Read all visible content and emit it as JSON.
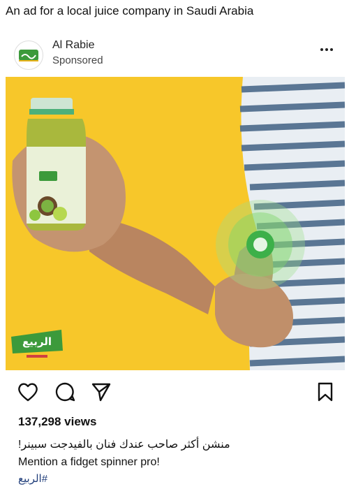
{
  "page": {
    "caption_top": "An ad for a local juice company in Saudi Arabia"
  },
  "post": {
    "author": "Al Rabie",
    "sponsored": "Sponsored",
    "more_icon": "more-horizontal-icon",
    "brand_colors": {
      "green": "#3c9a3b",
      "yellow_bg": "#f7c72a"
    },
    "photo": {
      "logo_text_arabic": "الربيع"
    },
    "actions": {
      "icons": [
        "heart-icon",
        "comment-icon",
        "share-icon",
        "bookmark-icon"
      ]
    },
    "views": "137,298 views",
    "caption_arabic": "منشن أكثر صاحب عندك فنان بالفيدجت سبينر!",
    "caption_english": "Mention a fidget spinner pro!",
    "hashtag": "#الربيع"
  }
}
